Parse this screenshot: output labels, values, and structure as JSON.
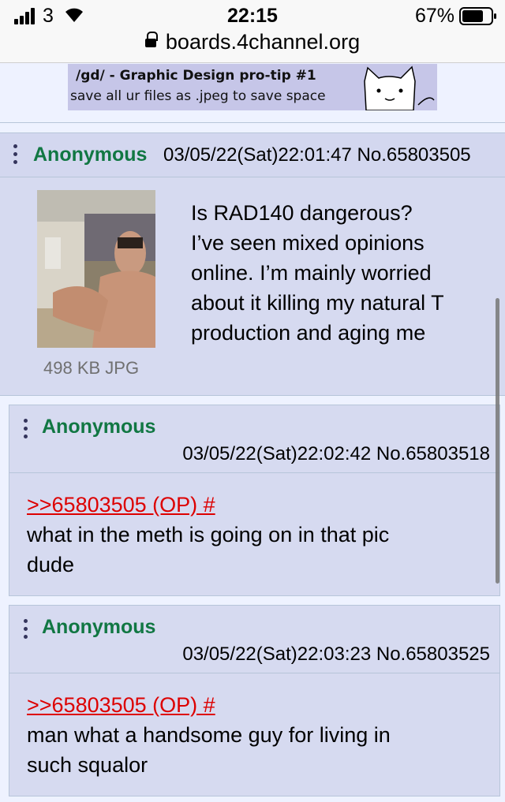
{
  "status_bar": {
    "carrier": "3",
    "time": "22:15",
    "battery": "67%",
    "url": "boards.4channel.org"
  },
  "banner": {
    "line1": "/gd/  - Graphic Design pro-tip #1",
    "line2": "save all ur files as .jpeg to save space"
  },
  "op": {
    "name": "Anonymous",
    "datetime": "03/05/22(Sat)22:01:47 No.65803505",
    "file_info": "498 KB JPG",
    "body_lines": [
      "Is RAD140 dangerous?",
      "I’ve seen mixed opinions",
      "online. I’m mainly worried",
      "about it killing my natural T",
      "production and aging me"
    ]
  },
  "replies": [
    {
      "name": "Anonymous",
      "datetime": "03/05/22(Sat)22:02:42 No.65803518",
      "quote": ">>65803505 (OP) #",
      "text_lines": [
        "what in the meth is going on in that pic",
        "dude"
      ]
    },
    {
      "name": "Anonymous",
      "datetime": "03/05/22(Sat)22:03:23 No.65803525",
      "quote": ">>65803505 (OP) #",
      "text_lines": [
        "man what a handsome guy for living in",
        "such squalor"
      ]
    }
  ],
  "colors": {
    "name": "#117743",
    "quote": "#dd0000",
    "post_bg": "#d6daf0",
    "page_bg": "#eef2ff"
  },
  "icons": [
    "signal-icon",
    "wifi-icon",
    "battery-icon",
    "lock-icon",
    "menu-dots-icon"
  ]
}
